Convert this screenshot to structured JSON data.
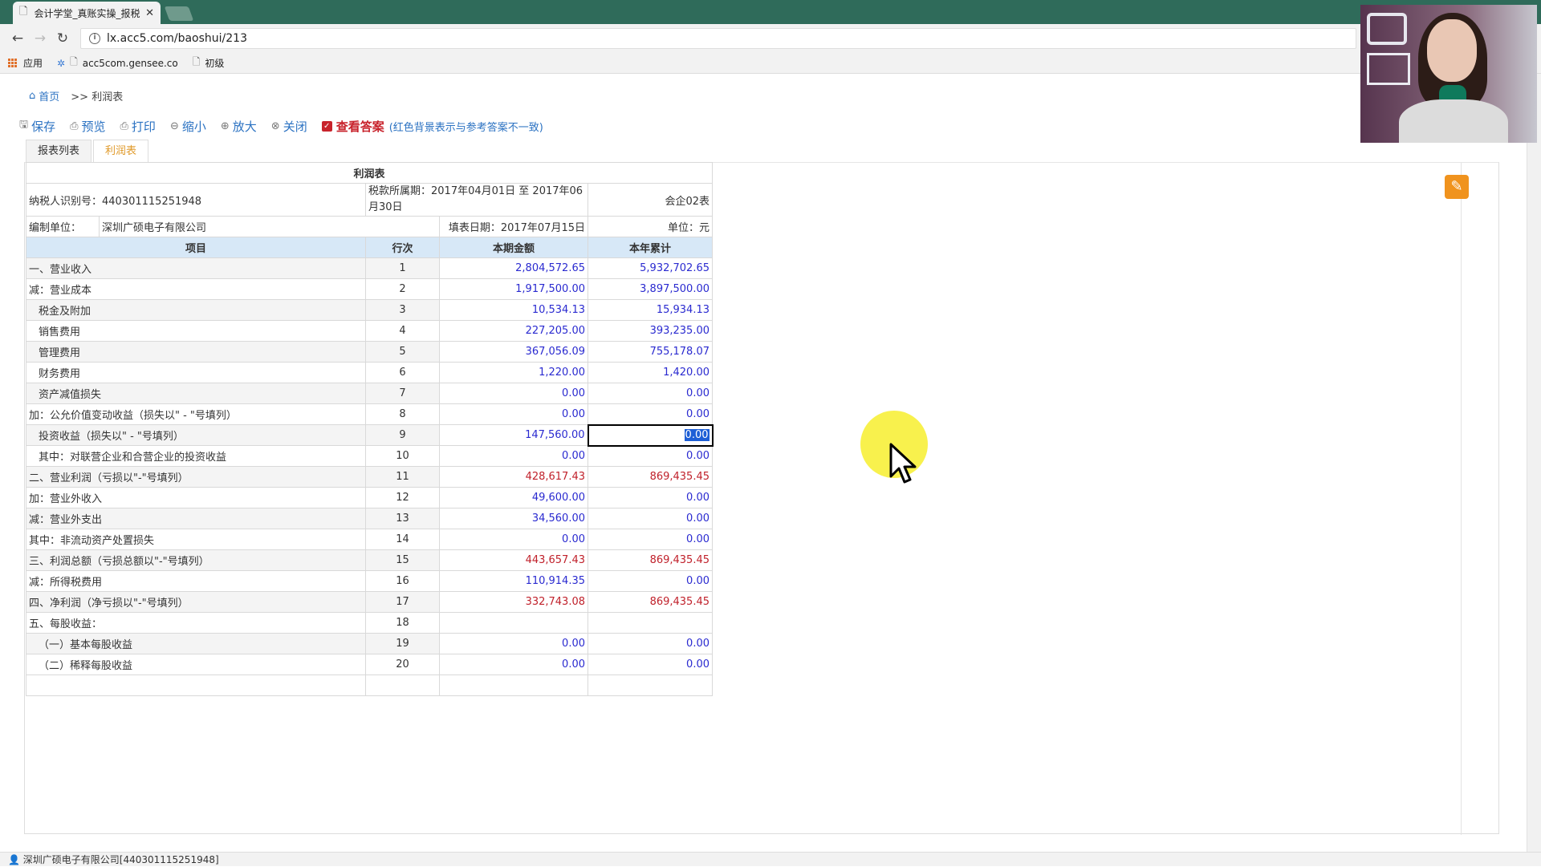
{
  "browser": {
    "tab_title": "会计学堂_真账实操_报税",
    "url": "lx.acc5.com/baoshui/213",
    "bookmarks": [
      "应用",
      "acc5com.gensee.co",
      "初级"
    ]
  },
  "breadcrumb": {
    "home": "首页",
    "current": ">> 利润表"
  },
  "toolbar": {
    "save": "保存",
    "preview": "预览",
    "print": "打印",
    "zoom_out": "缩小",
    "zoom_in": "放大",
    "close": "关闭",
    "view_answer": "查看答案",
    "hint": "(红色背景表示与参考答案不一致)"
  },
  "tabs": [
    "报表列表",
    "利润表"
  ],
  "report": {
    "title": "利润表",
    "taxpayer_id": "纳税人识别号：440301115251948",
    "period": "税款所属期：2017年04月01日 至 2017年06月30日",
    "form_code": "会企02表",
    "unit_label": "编制单位：",
    "unit_name": "深圳广硕电子有限公司",
    "fill_date": "填表日期：2017年07月15日",
    "currency": "单位：元",
    "headers": [
      "项目",
      "行次",
      "本期金额",
      "本年累计"
    ],
    "rows": [
      {
        "item": "一、营业收入",
        "line": "1",
        "current": "2,804,572.65",
        "ytd": "5,932,702.65"
      },
      {
        "item": "减：营业成本",
        "line": "2",
        "current": "1,917,500.00",
        "ytd": "3,897,500.00"
      },
      {
        "item": "税金及附加",
        "line": "3",
        "current": "10,534.13",
        "ytd": "15,934.13",
        "indent": true
      },
      {
        "item": "销售费用",
        "line": "4",
        "current": "227,205.00",
        "ytd": "393,235.00",
        "indent": true
      },
      {
        "item": "管理费用",
        "line": "5",
        "current": "367,056.09",
        "ytd": "755,178.07",
        "indent": true
      },
      {
        "item": "财务费用",
        "line": "6",
        "current": "1,220.00",
        "ytd": "1,420.00",
        "indent": true
      },
      {
        "item": "资产减值损失",
        "line": "7",
        "current": "0.00",
        "ytd": "0.00",
        "indent": true
      },
      {
        "item": "加：公允价值变动收益（损失以\" - \"号填列）",
        "line": "8",
        "current": "0.00",
        "ytd": "0.00"
      },
      {
        "item": "投资收益（损失以\" - \"号填列）",
        "line": "9",
        "current": "147,560.00",
        "ytd": "0.00",
        "indent": true,
        "selected": true
      },
      {
        "item": "其中：对联营企业和合营企业的投资收益",
        "line": "10",
        "current": "0.00",
        "ytd": "0.00",
        "indent": true
      },
      {
        "item": "二、营业利润（亏损以\"-\"号填列）",
        "line": "11",
        "current": "428,617.43",
        "ytd": "869,435.45",
        "red": true
      },
      {
        "item": "加：营业外收入",
        "line": "12",
        "current": "49,600.00",
        "ytd": "0.00"
      },
      {
        "item": "减：营业外支出",
        "line": "13",
        "current": "34,560.00",
        "ytd": "0.00"
      },
      {
        "item": "其中：非流动资产处置损失",
        "line": "14",
        "current": "0.00",
        "ytd": "0.00"
      },
      {
        "item": "三、利润总额（亏损总额以\"-\"号填列）",
        "line": "15",
        "current": "443,657.43",
        "ytd": "869,435.45",
        "red": true
      },
      {
        "item": "减：所得税费用",
        "line": "16",
        "current": "110,914.35",
        "ytd": "0.00"
      },
      {
        "item": "四、净利润（净亏损以\"-\"号填列）",
        "line": "17",
        "current": "332,743.08",
        "ytd": "869,435.45",
        "red": true
      },
      {
        "item": "五、每股收益：",
        "line": "18",
        "current": "",
        "ytd": ""
      },
      {
        "item": "（一）基本每股收益",
        "line": "19",
        "current": "0.00",
        "ytd": "0.00",
        "indent": true
      },
      {
        "item": "（二）稀释每股收益",
        "line": "20",
        "current": "0.00",
        "ytd": "0.00",
        "indent": true
      }
    ]
  },
  "statusbar": "深圳广硕电子有限公司[440301115251948]",
  "colors": {
    "link": "#2b72c2",
    "value": "#2a2ad0",
    "total": "#c0212b",
    "header_bg": "#d7e8f7"
  }
}
